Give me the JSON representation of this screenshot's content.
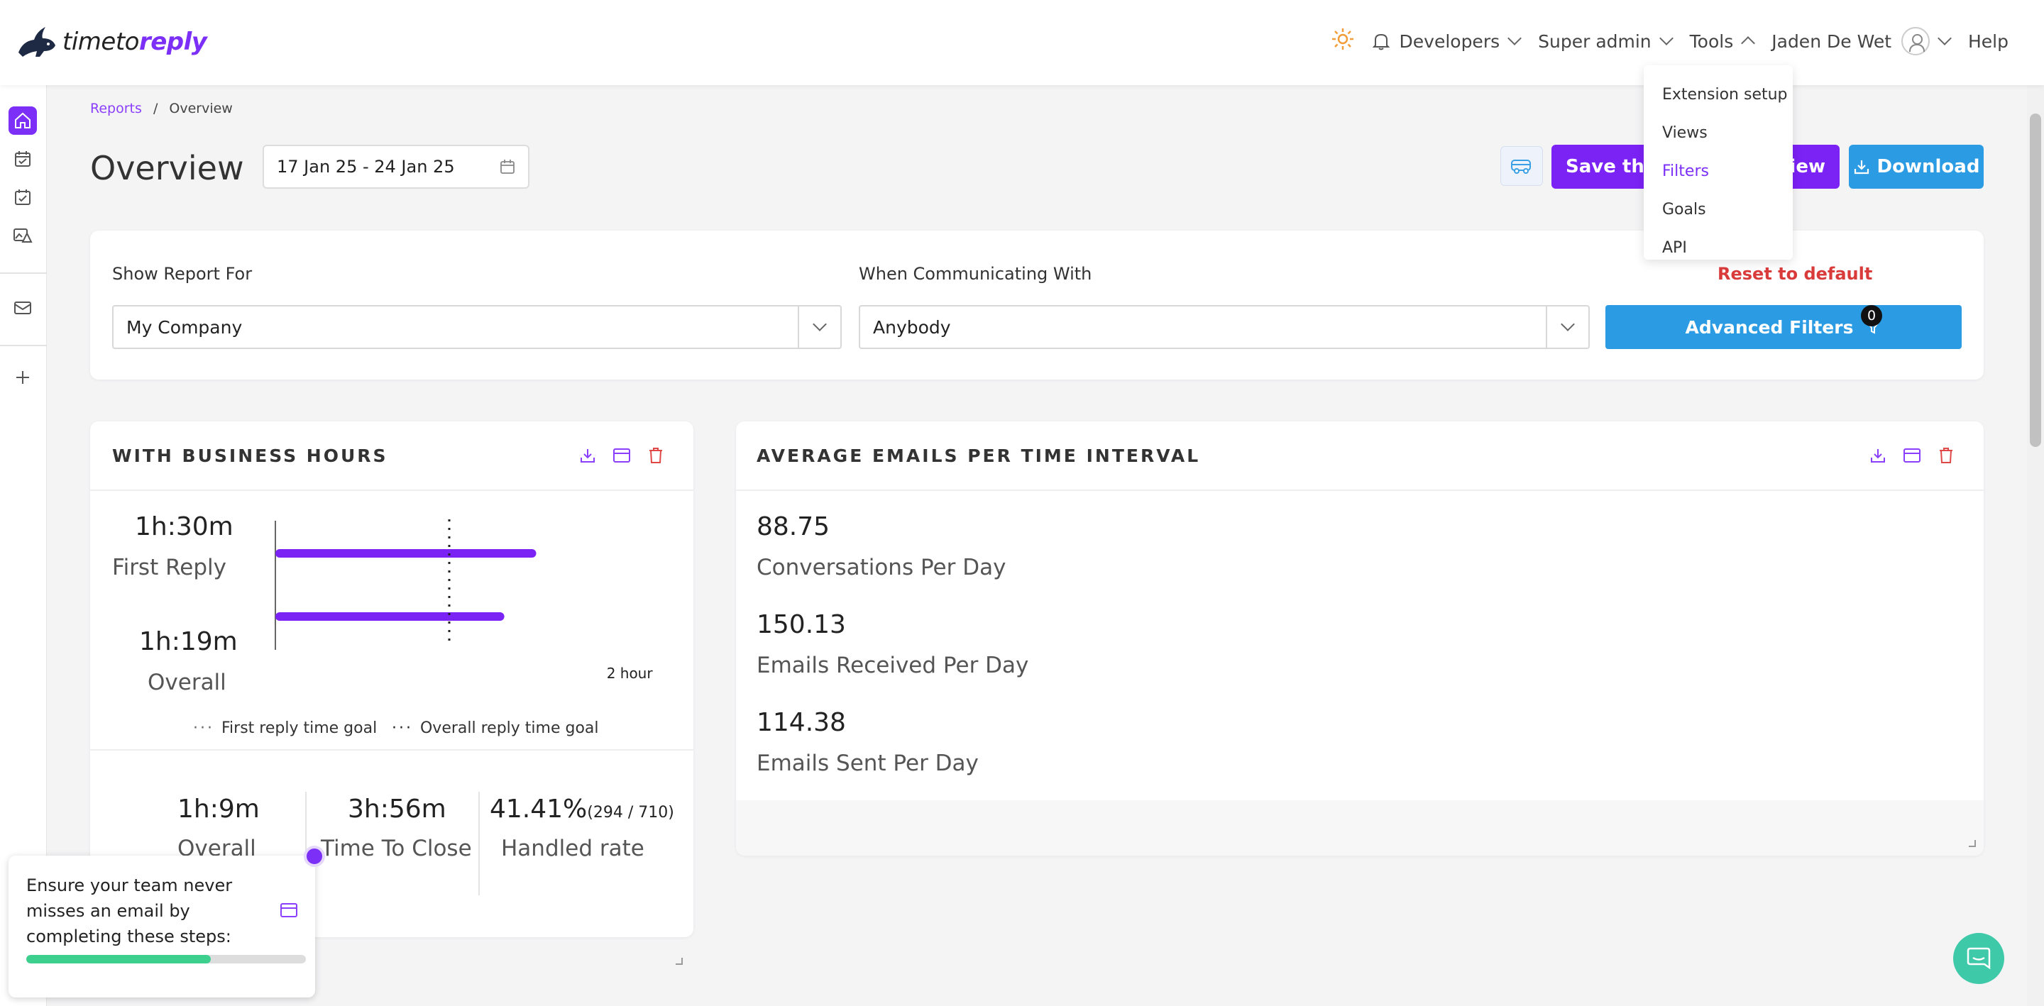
{
  "header": {
    "logo_word": "timeto",
    "logo_accent": "reply",
    "nav": {
      "developers": "Developers",
      "super_admin": "Super admin",
      "tools": "Tools",
      "user": "Jaden De Wet",
      "help": "Help"
    }
  },
  "tools_menu": {
    "items": [
      "Extension setup",
      "Views",
      "Filters",
      "Goals",
      "API"
    ],
    "active": "Filters"
  },
  "breadcrumb": {
    "root": "Reports",
    "separator": "/",
    "current": "Overview"
  },
  "page": {
    "title": "Overview",
    "date_range": "17 Jan 25 - 24 Jan 25",
    "save_button": "Save this",
    "save_button_tail": "View",
    "download_button": "Download"
  },
  "filters": {
    "show_for_label": "Show Report For",
    "show_for_value": "My Company",
    "communicating_label": "When Communicating With",
    "communicating_value": "Anybody",
    "reset_label": "Reset to default",
    "advanced_label": "Advanced Filters",
    "advanced_count": "0"
  },
  "business_hours": {
    "title": "WITH BUSINESS HOURS",
    "first_reply_value": "1h:30m",
    "first_reply_label": "First Reply",
    "overall_value": "1h:19m",
    "overall_label": "Overall",
    "axis_label": "2 hours",
    "legend_first": "First reply time goal",
    "legend_overall": "Overall reply time goal",
    "stats": {
      "overall_value": "1h:9m",
      "overall_label": "Overall",
      "close_value": "3h:56m",
      "close_label": "Time To Close",
      "handled_value": "41.41%",
      "handled_detail": "(294 / 710)",
      "handled_label": "Handled rate"
    }
  },
  "chart_data": {
    "type": "bar",
    "categories": [
      "First Reply",
      "Overall"
    ],
    "values": [
      90,
      79
    ],
    "xlim": [
      0,
      120
    ],
    "goal": 60,
    "xlabel": "2 hours"
  },
  "averages": {
    "title": "AVERAGE EMAILS PER TIME INTERVAL",
    "items": [
      {
        "value": "88.75",
        "label": "Conversations Per Day"
      },
      {
        "value": "150.13",
        "label": "Emails Received Per Day"
      },
      {
        "value": "114.38",
        "label": "Emails Sent Per Day"
      }
    ]
  },
  "onboarding": {
    "text": "Ensure your team never misses an email by completing these steps:",
    "progress": 0.66
  },
  "colors": {
    "purple": "#7b22f5",
    "blue": "#2b9be3",
    "red": "#d93b3b",
    "green": "#3ccf8e"
  }
}
